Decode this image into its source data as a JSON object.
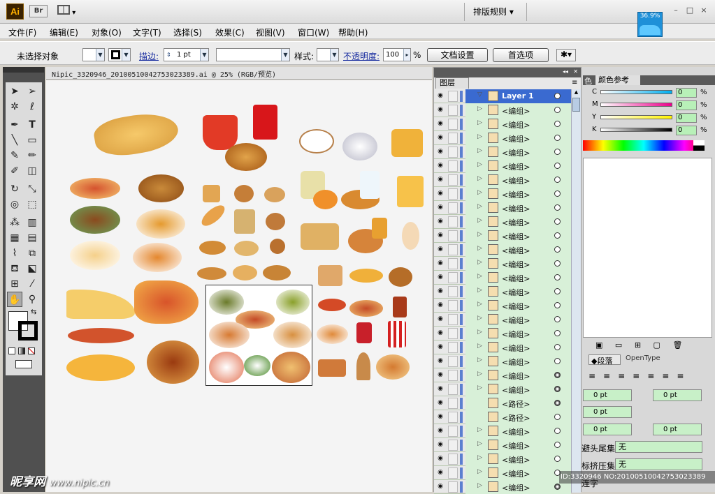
{
  "app": {
    "logo": "Ai",
    "bridge": "Br",
    "workspace": "排版规则",
    "zoom_badge": "36.9%"
  },
  "window": {
    "minimize": "–",
    "maximize": "□",
    "close": "×"
  },
  "menu": [
    "文件(F)",
    "编辑(E)",
    "对象(O)",
    "文字(T)",
    "选择(S)",
    "效果(C)",
    "视图(V)",
    "窗口(W)",
    "帮助(H)"
  ],
  "control": {
    "selection": "未选择对象",
    "stroke_label": "描边:",
    "stroke_value": "1 pt",
    "style_label": "样式:",
    "opacity_label": "不透明度:",
    "opacity_value": "100",
    "opacity_unit": "%",
    "doc_setup": "文档设置",
    "preferences": "首选项"
  },
  "document": {
    "tab_title": "Nipic_3320946_20100510042753023389.ai @ 25% (RGB/预览)"
  },
  "watermark": {
    "logo": "昵享网",
    "url": "www.nipic.cn"
  },
  "layers": {
    "tab": "图层",
    "rows": [
      {
        "name": "Layer 1",
        "type": "layer"
      },
      {
        "name": "<编组>"
      },
      {
        "name": "<编组>"
      },
      {
        "name": "<编组>"
      },
      {
        "name": "<编组>"
      },
      {
        "name": "<编组>"
      },
      {
        "name": "<编组>"
      },
      {
        "name": "<编组>"
      },
      {
        "name": "<编组>"
      },
      {
        "name": "<编组>"
      },
      {
        "name": "<编组>"
      },
      {
        "name": "<编组>"
      },
      {
        "name": "<编组>"
      },
      {
        "name": "<编组>"
      },
      {
        "name": "<编组>"
      },
      {
        "name": "<编组>"
      },
      {
        "name": "<编组>"
      },
      {
        "name": "<编组>"
      },
      {
        "name": "<编组>"
      },
      {
        "name": "<编组>"
      },
      {
        "name": "<编组>"
      },
      {
        "name": "<编组>"
      },
      {
        "name": "<路径>",
        "type": "path"
      },
      {
        "name": "<路径>",
        "type": "path"
      },
      {
        "name": "<编组>"
      },
      {
        "name": "<编组>"
      },
      {
        "name": "<编组>"
      },
      {
        "name": "<编组>"
      },
      {
        "name": "<编组>"
      }
    ]
  },
  "color_panel": {
    "tab_color_ref": "颜色参考",
    "tab_color_partial": "色",
    "channels": [
      {
        "label": "C",
        "value": "0",
        "unit": "%",
        "color": "#00aeef"
      },
      {
        "label": "M",
        "value": "0",
        "unit": "%",
        "color": "#ec008c"
      },
      {
        "label": "Y",
        "value": "0",
        "unit": "%",
        "color": "#fff200"
      },
      {
        "label": "K",
        "value": "0",
        "unit": "%",
        "color": "#000000"
      }
    ]
  },
  "paragraph_panel": {
    "tab": "段落",
    "tab_opentype": "OpenType",
    "fields": [
      "0 pt",
      "0 pt",
      "0 pt",
      "0 pt",
      "0 pt"
    ],
    "hanging_label": "避头尾集:",
    "hanging_value": "无",
    "kinsoku_label": "标挤压集:",
    "kinsoku_value": "无",
    "ligature": "连字"
  },
  "footer": {
    "id_text": "ID:3320946 NO:20100510042753023389"
  }
}
